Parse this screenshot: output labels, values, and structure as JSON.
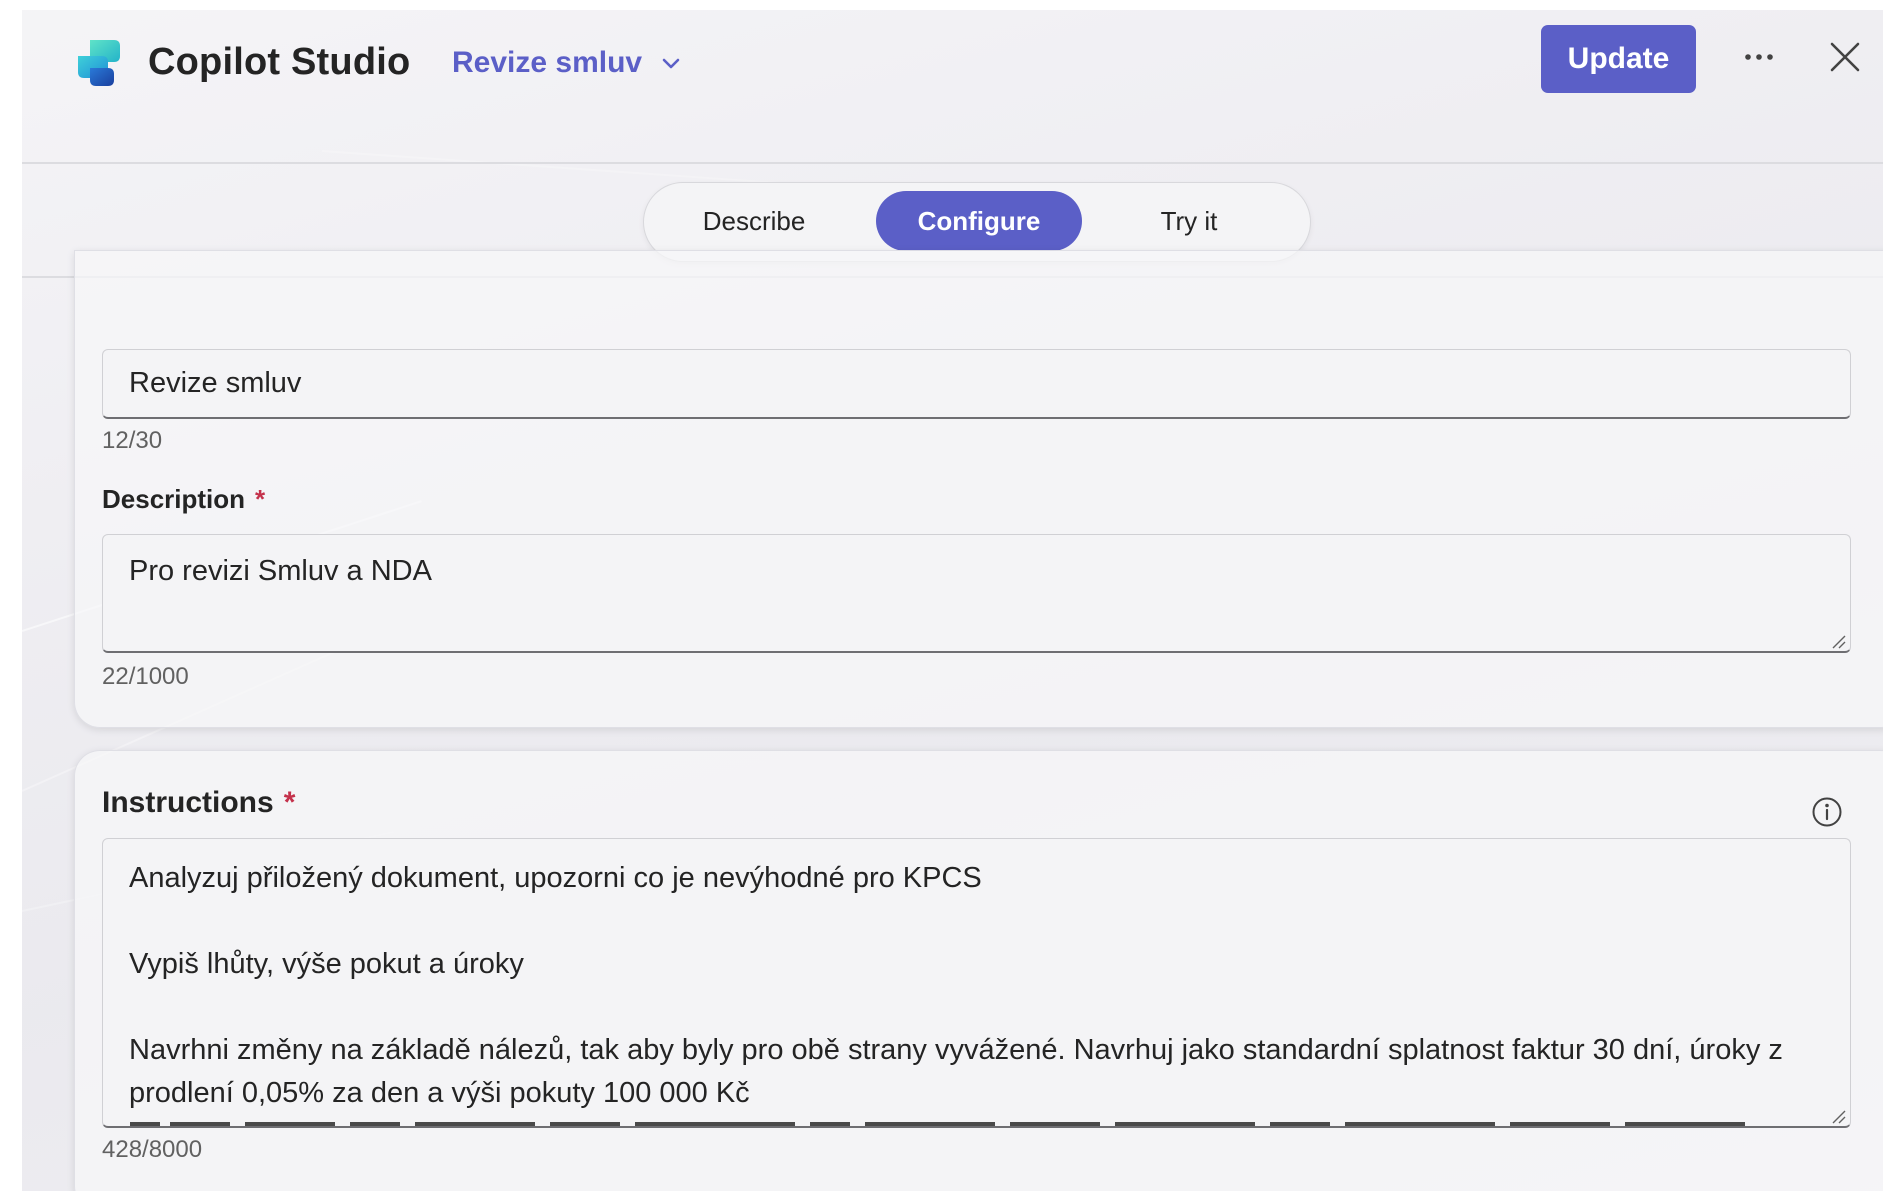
{
  "app": {
    "title": "Copilot Studio",
    "agent_name": "Revize smluv",
    "update_label": "Update",
    "brand_color": "#5b5fc7"
  },
  "tabs": [
    {
      "label": "Describe",
      "active": false
    },
    {
      "label": "Configure",
      "active": true
    },
    {
      "label": "Try it",
      "active": false
    }
  ],
  "form": {
    "name": {
      "value": "Revize smluv",
      "counter": "12/30"
    },
    "description": {
      "label": "Description",
      "required_mark": "*",
      "value": "Pro revizi Smluv a NDA",
      "counter": "22/1000"
    },
    "instructions": {
      "label": "Instructions",
      "required_mark": "*",
      "value": "Analyzuj přiložený dokument, upozorni co je nevýhodné pro KPCS\n\nVypiš lhůty, výše pokut a úroky\n\nNavrhni změny na základě nálezů, tak aby byly pro obě strany vyvážené. Navrhuj jako standardní splatnost faktur 30 dní, úroky z prodlení 0,05% za den a výši pokuty 100 000 Kč",
      "counter": "428/8000"
    }
  },
  "icons": {
    "logo": "copilot-studio-logo",
    "chevron": "chevron-down-icon",
    "more": "more-horizontal-icon",
    "close": "close-icon",
    "info": "info-icon"
  }
}
